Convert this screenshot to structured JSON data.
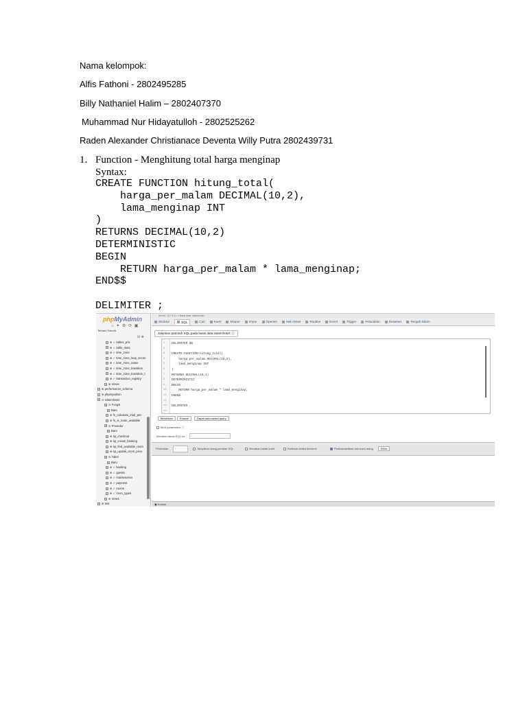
{
  "header": {
    "group_label": "Nama kelompok:",
    "members": [
      "Alfis Fathoni - 2802495285",
      "Billy Nathaniel Halim – 2802407370",
      "Muhammad Nur Hidayatulloh - 2802525262",
      "Raden Alexander Christianace Deventa Willy Putra 2802439731"
    ]
  },
  "section": {
    "number": "1.",
    "title": "Function - Menghitung total harga menginap",
    "syntax_label": "Syntax:",
    "code": "CREATE FUNCTION hitung_total(\n    harga_per_malam DECIMAL(10,2),\n    lama_menginap INT\n)\nRETURNS DECIMAL(10,2)\nDETERMINISTIC\nBEGIN\n    RETURN harga_per_malam * lama_menginap;\nEND$$\n\nDELIMITER ;"
  },
  "screenshot": {
    "logo_a": "php",
    "logo_b": "MyAdmin",
    "nav_icons": "⌂ ✦ ⚙ ⟳ ▣",
    "nav_tabs": "Terbaru  Favorit",
    "collapse_icon": "⊟ ⊕",
    "tree": [
      "⊕ ✓ tables_priv",
      "⊕ ✓ table_stats",
      "⊕ ✓ time_zone",
      "⊕ ✓ time_zone_leap_secon",
      "⊕ ✓ time_zone_name",
      "⊕ ✓ time_zone_transition",
      "⊕ ✓ time_zone_transition_t",
      "⊕ ✓ transaction_registry",
      "⊕ Views",
      "⊕ performance_schema",
      "⊕ phpmyadmin",
      "⊖ sistemhotel",
      "⊖ Fungsi",
      "Baru",
      "⊕ fn_calculate_total_pric",
      "⊕ fn_is_room_available",
      "⊖ Prosedur",
      "Baru",
      "⊕ sp_checkout",
      "⊕ sp_create_booking",
      "⊕ sp_find_available_room",
      "⊕ sp_update_room_price",
      "⊖ Tabel",
      "Baru",
      "⊕ ✓ booking",
      "⊕ ✓ guests",
      "⊕ ✓ maintenance",
      "⊕ ✓ payment",
      "⊕ ✓ rooms",
      "⊕ ✓ room_types",
      "⊕ Views",
      "⊕ test"
    ],
    "breadcrumb": "Server: 127.0.0.1 » Basis data: sistemhotel",
    "tabs": [
      "Struktur",
      "SQL",
      "Cari",
      "Kueri",
      "Ekspor",
      "Impor",
      "Operasi",
      "Hak Akses",
      "Routine",
      "Event",
      "Trigger",
      "Pelacakan",
      "Desainer",
      "Tengah kolom"
    ],
    "query_heading": "Jalankan perintah SQL pada basis data sistemhotel: ⓘ",
    "gutter": "1\n2\n3\n4\n5\n6\n7\n8\n9\n10\n11\n12\n13\n14",
    "sql": "DELIMITER $$\n\nCREATE FUNCTION hitung_total(\n    harga_per_malam DECIMAL(10,2),\n    lama_menginap INT\n)\nRETURNS DECIMAL(10,2)\nDETERMINISTIC\nBEGIN\n    RETURN harga_per_malam * lama_menginap;\nEND$$\n\nDELIMITER ;\n",
    "buttons": [
      "Bersihkan",
      "Format",
      "Dapat auto-saved query"
    ],
    "bind_params": "Bind parameters ⓘ",
    "bookmark_label": "Memberi tanda SQL ini:",
    "delimiter_label": "Pembatas",
    "delimiter_value": ";",
    "show_query": "Tampilkan ulang perintah SQL",
    "retain_box": "Menahan kotak kueri",
    "rollback": "Rollback ketika berhenti",
    "foreign_keys": "Periksa/aktifkan cek kunci asing",
    "go_button": "Kirim",
    "console": "▣ Konsol"
  }
}
